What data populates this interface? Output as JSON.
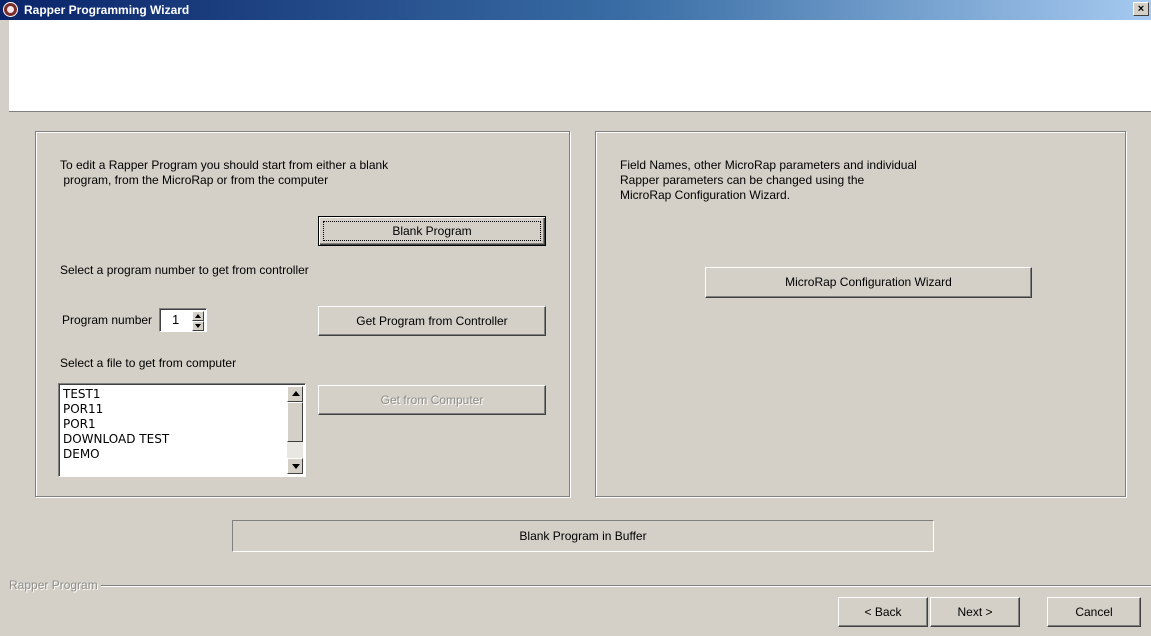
{
  "window": {
    "title": "Rapper Programming Wizard",
    "close_glyph": "×"
  },
  "left_panel": {
    "intro_line1": "To edit a Rapper Program you should start from either a blank",
    "intro_line2": " program, from the MicroRap or from the computer",
    "blank_program_label": "Blank Program",
    "select_program_label": "Select a program number to get from controller",
    "program_number_label": "Program number",
    "program_number_value": "1",
    "get_from_controller_label": "Get Program from Controller",
    "select_file_label": "Select a file to get from computer",
    "files": [
      "TEST1",
      "POR11",
      "POR1",
      "DOWNLOAD TEST",
      "DEMO"
    ],
    "get_from_computer_label": "Get from Computer"
  },
  "right_panel": {
    "info_line1": "Field Names, other MicroRap parameters and individual",
    "info_line2": "Rapper parameters can be changed using the",
    "info_line3": "MicroRap Configuration Wizard.",
    "config_wizard_label": "MicroRap Configuration Wizard"
  },
  "status": {
    "text": "Blank Program in Buffer"
  },
  "footer": {
    "group_label": "Rapper Program",
    "back_label": "< Back",
    "next_label": "Next >",
    "cancel_label": "Cancel"
  },
  "icons": {
    "app": "rapper-app-icon",
    "close": "close-icon",
    "spin_up": "spin-up-arrow-icon",
    "spin_down": "spin-down-arrow-icon",
    "scroll_up": "scroll-up-arrow-icon",
    "scroll_down": "scroll-down-arrow-icon"
  }
}
